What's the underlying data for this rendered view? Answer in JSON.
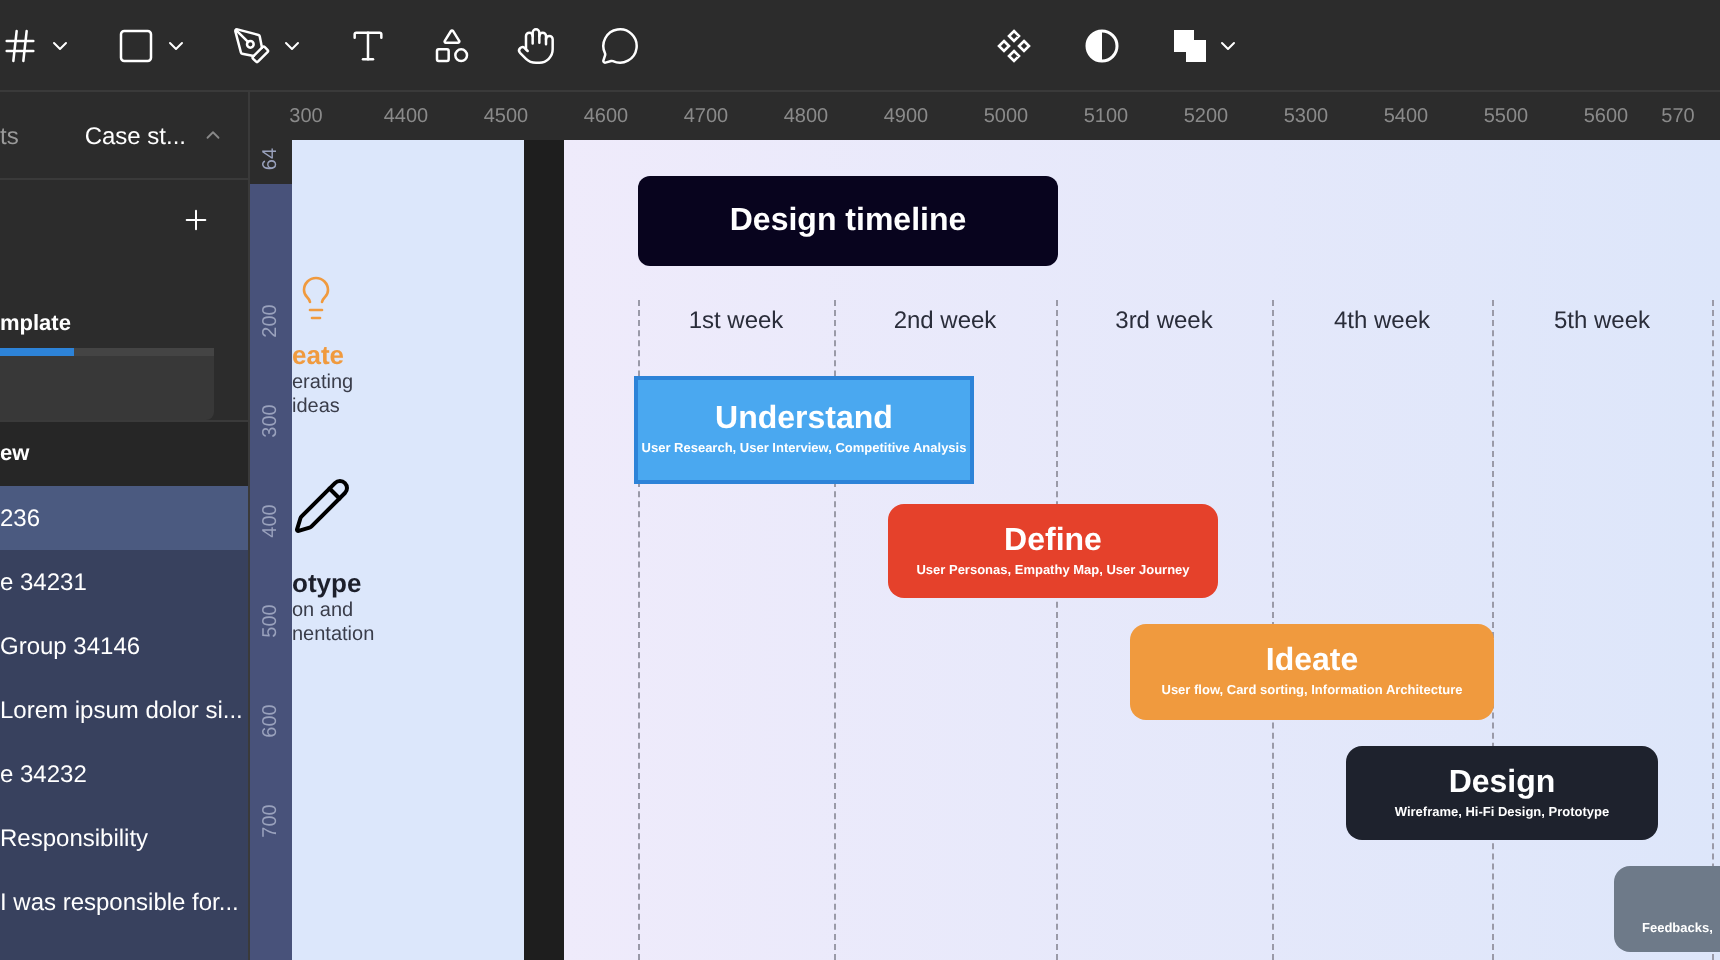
{
  "toolbar": {
    "tools": [
      {
        "kind": "frame",
        "menu": true
      },
      {
        "kind": "rectangle",
        "menu": true
      },
      {
        "kind": "pen",
        "menu": true
      },
      {
        "kind": "text",
        "menu": false
      },
      {
        "kind": "resources",
        "menu": false
      },
      {
        "kind": "hand",
        "menu": false
      },
      {
        "kind": "comment",
        "menu": false
      }
    ],
    "center_tools": [
      {
        "kind": "component",
        "menu": false
      },
      {
        "kind": "mask",
        "menu": false
      },
      {
        "kind": "boolean",
        "menu": true
      }
    ]
  },
  "left_panel": {
    "tabs": [
      {
        "label": "ts",
        "selected": false
      },
      {
        "label": "Case st...",
        "selected": true
      }
    ],
    "page_title": "mplate",
    "progress": {
      "level": 0.35
    },
    "section_title": "ew",
    "layers": [
      {
        "label": "236",
        "selected": true
      },
      {
        "label": "e 34231",
        "selected": false
      },
      {
        "label": "Group 34146",
        "selected": false
      },
      {
        "label": "Lorem ipsum dolor si...",
        "selected": false
      },
      {
        "label": "e 34232",
        "selected": false
      },
      {
        "label": "Responsibility",
        "selected": false
      },
      {
        "label": "I was responsible for...",
        "selected": false
      }
    ]
  },
  "rulers": {
    "horizontal": [
      "300",
      "4400",
      "4500",
      "4600",
      "4700",
      "4800",
      "4900",
      "5000",
      "5100",
      "5200",
      "5300",
      "5400",
      "5500",
      "5600",
      "570"
    ],
    "vertical": [
      "64",
      "200",
      "300",
      "400",
      "500",
      "600",
      "700"
    ]
  },
  "side_frame": {
    "steps": [
      {
        "kind": "bulb",
        "title": "eate",
        "lines": [
          "erating",
          "ideas"
        ]
      },
      {
        "kind": "pencil",
        "title": "otype",
        "lines": [
          "on and",
          "nentation"
        ]
      }
    ]
  },
  "timeline": {
    "title": "Design timeline",
    "weeks": [
      "1st week",
      "2nd week",
      "3rd week",
      "4th week",
      "5th week"
    ],
    "phases": [
      {
        "title": "Understand",
        "detail": "User Research, User Interview, Competitive Analysis",
        "color": "#4aa8f0",
        "selected": true
      },
      {
        "title": "Define",
        "detail": "User Personas, Empathy Map, User Journey",
        "color": "#e5412b",
        "selected": false
      },
      {
        "title": "Ideate",
        "detail": "User flow, Card sorting, Information Architecture",
        "color": "#f09a3e",
        "selected": false
      },
      {
        "title": "Design",
        "detail": "Wireframe, Hi-Fi Design, Prototype",
        "color": "#1e222d",
        "selected": false
      },
      {
        "detail": "Feedbacks,",
        "color": "#6e7a89",
        "selected": false
      }
    ]
  }
}
